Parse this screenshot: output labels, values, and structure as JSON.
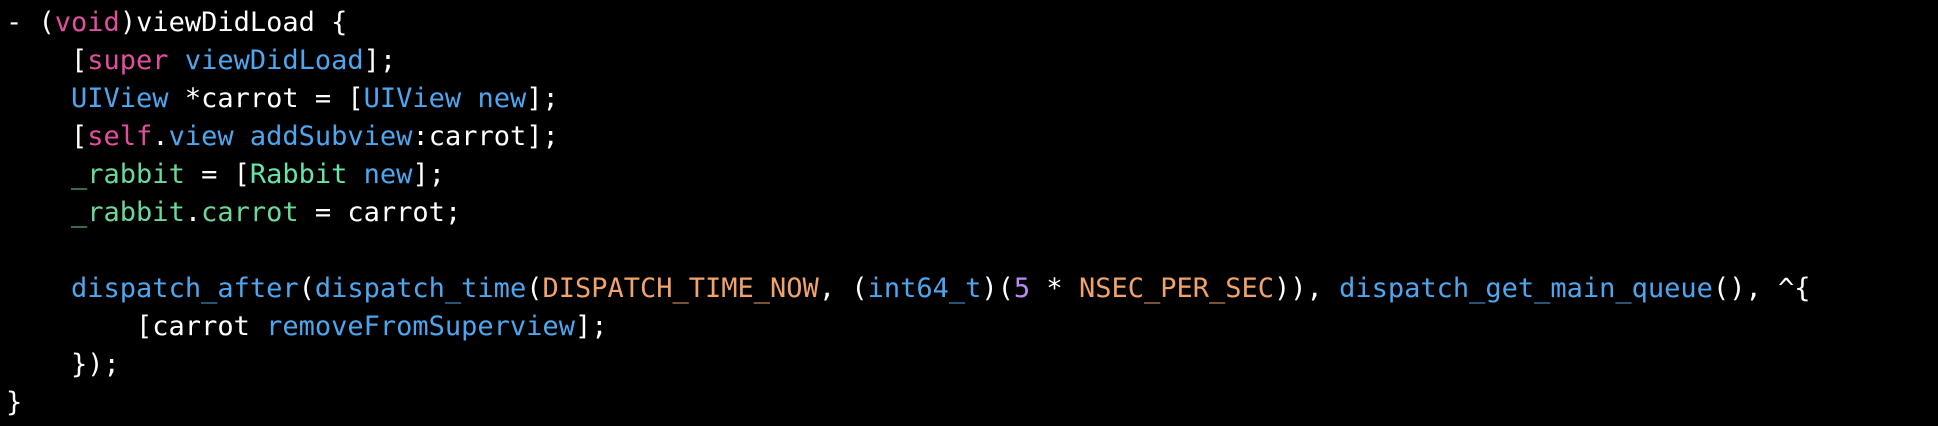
{
  "palette": {
    "background": "#000000",
    "plain": "#ffffff",
    "keyword": "#e0509e",
    "method": "#4ea6ee",
    "ivar": "#6bd89a",
    "class_user": "#67e5a8",
    "macro": "#f0a36a",
    "number": "#b88cf4"
  },
  "lines": [
    {
      "tokens": [
        {
          "t": "- (",
          "c": "plain"
        },
        {
          "t": "void",
          "c": "keyword"
        },
        {
          "t": ")viewDidLoad {",
          "c": "plain"
        }
      ]
    },
    {
      "tokens": [
        {
          "t": "    [",
          "c": "plain"
        },
        {
          "t": "super",
          "c": "keyword"
        },
        {
          "t": " ",
          "c": "plain"
        },
        {
          "t": "viewDidLoad",
          "c": "method"
        },
        {
          "t": "];",
          "c": "plain"
        }
      ]
    },
    {
      "tokens": [
        {
          "t": "    ",
          "c": "plain"
        },
        {
          "t": "UIView",
          "c": "method"
        },
        {
          "t": " *carrot = [",
          "c": "plain"
        },
        {
          "t": "UIView",
          "c": "method"
        },
        {
          "t": " ",
          "c": "plain"
        },
        {
          "t": "new",
          "c": "method"
        },
        {
          "t": "];",
          "c": "plain"
        }
      ]
    },
    {
      "tokens": [
        {
          "t": "    [",
          "c": "plain"
        },
        {
          "t": "self",
          "c": "keyword"
        },
        {
          "t": ".",
          "c": "plain"
        },
        {
          "t": "view",
          "c": "method"
        },
        {
          "t": " ",
          "c": "plain"
        },
        {
          "t": "addSubview",
          "c": "method"
        },
        {
          "t": ":carrot];",
          "c": "plain"
        }
      ]
    },
    {
      "tokens": [
        {
          "t": "    ",
          "c": "plain"
        },
        {
          "t": "_rabbit",
          "c": "ivar"
        },
        {
          "t": " = [",
          "c": "plain"
        },
        {
          "t": "Rabbit",
          "c": "class_user"
        },
        {
          "t": " ",
          "c": "plain"
        },
        {
          "t": "new",
          "c": "method"
        },
        {
          "t": "];",
          "c": "plain"
        }
      ]
    },
    {
      "tokens": [
        {
          "t": "    ",
          "c": "plain"
        },
        {
          "t": "_rabbit",
          "c": "ivar"
        },
        {
          "t": ".",
          "c": "plain"
        },
        {
          "t": "carrot",
          "c": "ivar"
        },
        {
          "t": " = carrot;",
          "c": "plain"
        }
      ]
    },
    {
      "tokens": [
        {
          "t": "",
          "c": "plain"
        }
      ]
    },
    {
      "tokens": [
        {
          "t": "    ",
          "c": "plain"
        },
        {
          "t": "dispatch_after",
          "c": "method"
        },
        {
          "t": "(",
          "c": "plain"
        },
        {
          "t": "dispatch_time",
          "c": "method"
        },
        {
          "t": "(",
          "c": "plain"
        },
        {
          "t": "DISPATCH_TIME_NOW",
          "c": "macro"
        },
        {
          "t": ", (",
          "c": "plain"
        },
        {
          "t": "int64_t",
          "c": "method"
        },
        {
          "t": ")(",
          "c": "plain"
        },
        {
          "t": "5",
          "c": "number"
        },
        {
          "t": " * ",
          "c": "plain"
        },
        {
          "t": "NSEC_PER_SEC",
          "c": "macro"
        },
        {
          "t": ")), ",
          "c": "plain"
        },
        {
          "t": "dispatch_get_main_queue",
          "c": "method"
        },
        {
          "t": "(), ^{",
          "c": "plain"
        }
      ]
    },
    {
      "tokens": [
        {
          "t": "        [carrot ",
          "c": "plain"
        },
        {
          "t": "removeFromSuperview",
          "c": "method"
        },
        {
          "t": "];",
          "c": "plain"
        }
      ]
    },
    {
      "tokens": [
        {
          "t": "    });",
          "c": "plain"
        }
      ]
    },
    {
      "tokens": [
        {
          "t": "}",
          "c": "plain"
        }
      ]
    }
  ]
}
